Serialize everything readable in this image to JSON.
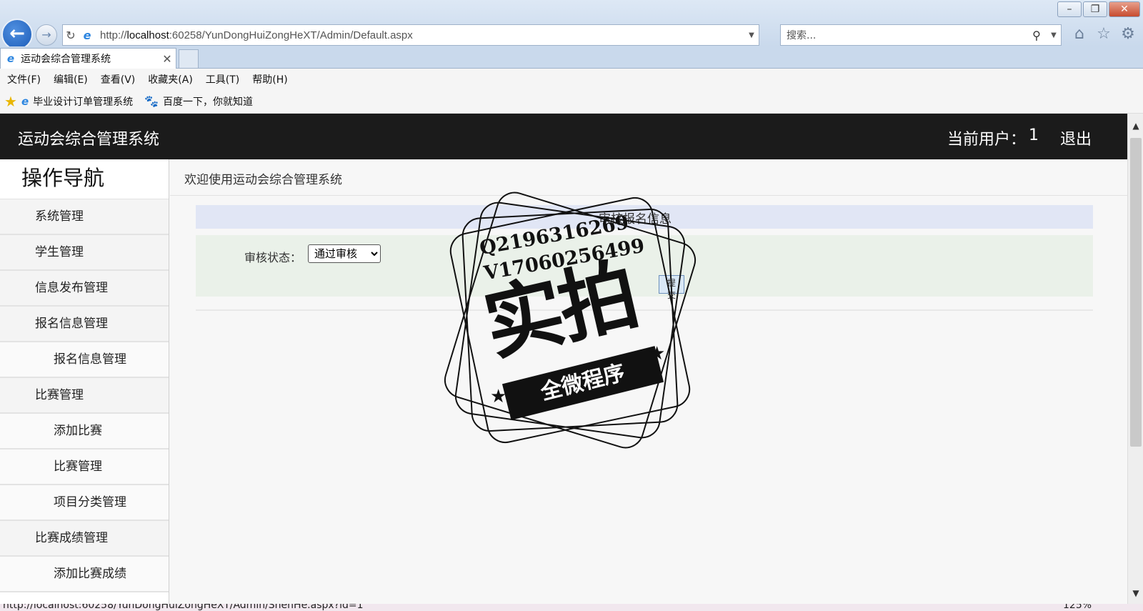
{
  "browser": {
    "url_prefix": "http://",
    "url_host": "localhost",
    "url_rest": ":60258/YunDongHuiZongHeXT/Admin/Default.aspx",
    "search_placeholder": "搜索...",
    "tab_title": "运动会综合管理系统",
    "menu": [
      "文件(F)",
      "编辑(E)",
      "查看(V)",
      "收藏夹(A)",
      "工具(T)",
      "帮助(H)"
    ],
    "favorites": [
      "毕业设计订单管理系统",
      "百度一下，你就知道"
    ],
    "status_url": "http://localhost:60258/YunDongHuiZongHeXT/Admin/ShenHe.aspx?id=1",
    "zoom": "125%"
  },
  "header": {
    "title": "运动会综合管理系统",
    "user_label": "当前用户：",
    "user_value": "1",
    "logout": "退出"
  },
  "sidebar": {
    "heading": "操作导航",
    "items": [
      {
        "label": "系统管理",
        "level": 1
      },
      {
        "label": "学生管理",
        "level": 1
      },
      {
        "label": "信息发布管理",
        "level": 1
      },
      {
        "label": "报名信息管理",
        "level": 1
      },
      {
        "label": "报名信息管理",
        "level": 2
      },
      {
        "label": "比赛管理",
        "level": 1
      },
      {
        "label": "添加比赛",
        "level": 2
      },
      {
        "label": "比赛管理",
        "level": 2
      },
      {
        "label": "项目分类管理",
        "level": 2
      },
      {
        "label": "比赛成绩管理",
        "level": 1
      },
      {
        "label": "添加比赛成绩",
        "level": 2
      }
    ]
  },
  "main": {
    "welcome": "欢迎使用运动会综合管理系统",
    "panel_title": "审核报名信息",
    "status_label": "审核状态：",
    "status_selected": "通过审核",
    "submit_label": "提交"
  },
  "watermark": {
    "line1": "Q2196316269",
    "line2": "V17060256499",
    "big": "实拍",
    "banner": "全微程序"
  }
}
